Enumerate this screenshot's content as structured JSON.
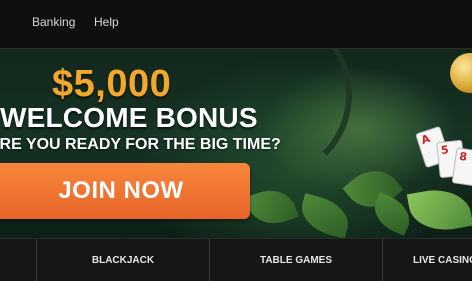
{
  "nav": {
    "links": [
      "Banking",
      "Help"
    ]
  },
  "hero": {
    "amount": "$5,000",
    "title": "WELCOME BONUS",
    "subtitle": "ARE YOU READY FOR THE BIG TIME?",
    "cta_label": "JOIN NOW",
    "cards": [
      "A",
      "5",
      "8"
    ]
  },
  "categories": [
    "BLACKJACK",
    "TABLE GAMES",
    "LIVE CASINO"
  ],
  "colors": {
    "accent_orange": "#f3a72c",
    "button_orange": "#e8642a",
    "background": "#111111"
  }
}
